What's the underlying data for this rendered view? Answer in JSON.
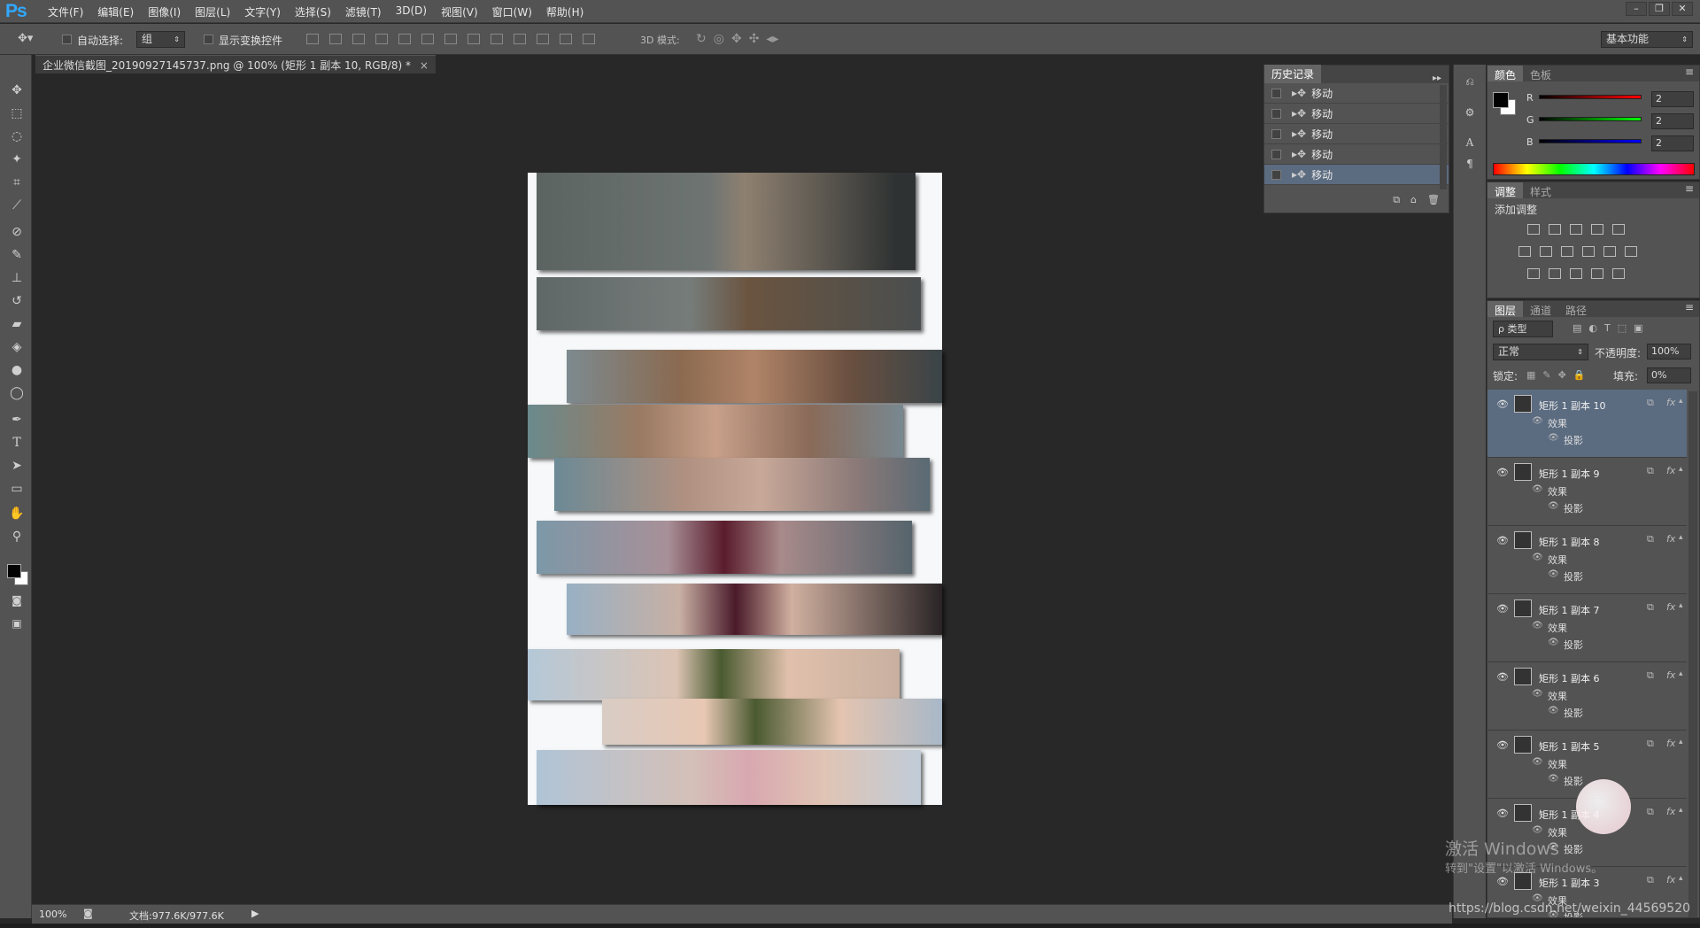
{
  "app": {
    "logo": "Ps"
  },
  "menu": [
    "文件(F)",
    "编辑(E)",
    "图像(I)",
    "图层(L)",
    "文字(Y)",
    "选择(S)",
    "滤镜(T)",
    "3D(D)",
    "视图(V)",
    "窗口(W)",
    "帮助(H)"
  ],
  "window_controls": [
    "–",
    "❐",
    "✕"
  ],
  "options": {
    "auto_select_label": "自动选择:",
    "auto_select_value": "组",
    "show_transform_label": "显示变换控件",
    "mode_3d_label": "3D 模式:",
    "workspace": "基本功能"
  },
  "document": {
    "tab_title": "企业微信截图_20190927145737.png @ 100% (矩形 1 副本 10, RGB/8) *",
    "close": "×"
  },
  "status": {
    "zoom": "100%",
    "doc_info": "文档:977.6K/977.6K"
  },
  "history": {
    "title": "历史记录",
    "items": [
      "移动",
      "移动",
      "移动",
      "移动",
      "移动"
    ],
    "selected_index": 4
  },
  "color_panel": {
    "tabs": [
      "颜色",
      "色板"
    ],
    "r_label": "R",
    "g_label": "G",
    "b_label": "B",
    "r": "2",
    "g": "2",
    "b": "2",
    "foreground": "#020202",
    "background": "#ffffff"
  },
  "adjust_panel": {
    "tabs": [
      "调整",
      "样式"
    ],
    "heading": "添加调整"
  },
  "layers_panel": {
    "tabs": [
      "图层",
      "通道",
      "路径"
    ],
    "filter_kind": "ρ 类型",
    "blend_mode": "正常",
    "opacity_label": "不透明度:",
    "opacity": "100%",
    "lock_label": "锁定:",
    "fill_label": "填充:",
    "fill": "0%",
    "effects_label": "效果",
    "shadow_label": "投影",
    "layers": [
      {
        "name": "矩形 1 副本 10",
        "selected": true
      },
      {
        "name": "矩形 1 副本 9"
      },
      {
        "name": "矩形 1 副本 8"
      },
      {
        "name": "矩形 1 副本 7"
      },
      {
        "name": "矩形 1 副本 6"
      },
      {
        "name": "矩形 1 副本 5"
      },
      {
        "name": "矩形 1 副本 4"
      },
      {
        "name": "矩形 1 副本 3"
      }
    ]
  },
  "watermark": {
    "activate_title": "激活 Windows",
    "activate_sub": "转到\"设置\"以激活 Windows。",
    "url": "https://blog.csdn.net/weixin_44569520"
  },
  "colors": {
    "ui_panel": "#535353",
    "canvas_bg": "#282828",
    "selection": "#5b6b80",
    "ps_blue": "#31a8ff"
  }
}
